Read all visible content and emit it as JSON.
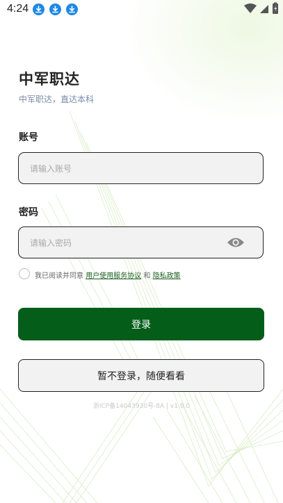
{
  "status_bar": {
    "time": "4:24",
    "icons": [
      "download-icon",
      "download-icon",
      "download-icon",
      "wifi-icon",
      "signal-icon",
      "battery-icon"
    ]
  },
  "header": {
    "title": "中军职达",
    "subtitle": "中军职达，直达本科"
  },
  "account": {
    "label": "账号",
    "placeholder": "请输入账号",
    "value": ""
  },
  "password": {
    "label": "密码",
    "placeholder": "请输入密码",
    "value": ""
  },
  "agreement": {
    "checked": false,
    "prefix": "我已阅读并同意",
    "terms_link": "用户使用服务协议",
    "and": "和",
    "privacy_link": "隐私政策"
  },
  "buttons": {
    "login": "登录",
    "guest": "暂不登录，随便看看"
  },
  "footer": "浙ICP备14043930号-8A | v1.0.0",
  "colors": {
    "primary": "#045e19",
    "link": "#1b5e20",
    "status_icon": "#1e88e5"
  }
}
